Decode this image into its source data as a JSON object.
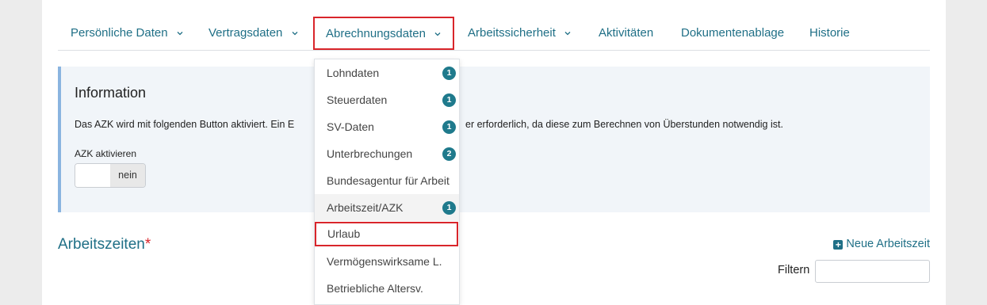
{
  "tabs": [
    {
      "label": "Persönliche Daten",
      "has_chevron": true
    },
    {
      "label": "Vertragsdaten",
      "has_chevron": true
    },
    {
      "label": "Abrechnungsdaten",
      "has_chevron": true,
      "active": true
    },
    {
      "label": "Arbeitssicherheit",
      "has_chevron": true
    },
    {
      "label": "Aktivitäten",
      "has_chevron": false
    },
    {
      "label": "Dokumentenablage",
      "has_chevron": false
    },
    {
      "label": "Historie",
      "has_chevron": false
    }
  ],
  "info": {
    "title": "Information",
    "text_start": "Das AZK wird mit folgenden Button aktiviert. Ein E",
    "text_end": "er erforderlich, da diese zum Berechnen von Überstunden notwendig ist.",
    "azk_label": "AZK aktivieren",
    "toggle_value": "nein"
  },
  "dropdown": {
    "items": [
      {
        "label": "Lohndaten",
        "badge": "1"
      },
      {
        "label": "Steuerdaten",
        "badge": "1"
      },
      {
        "label": "SV-Daten",
        "badge": "1"
      },
      {
        "label": "Unterbrechungen",
        "badge": "2"
      },
      {
        "label": "Bundesagentur für Arbeit",
        "badge": ""
      },
      {
        "label": "Arbeitszeit/AZK",
        "badge": "1"
      },
      {
        "label": "Urlaub",
        "badge": ""
      },
      {
        "label": "Vermögenswirksame L.",
        "badge": ""
      },
      {
        "label": "Betriebliche Altersv.",
        "badge": ""
      }
    ]
  },
  "section": {
    "title": "Arbeitszeiten",
    "required_mark": "*",
    "new_button": "Neue Arbeitszeit",
    "filter_label": "Filtern"
  },
  "colors": {
    "accent": "#1f6f86",
    "highlight_border": "#d9252b",
    "badge": "#1f7a8c"
  }
}
